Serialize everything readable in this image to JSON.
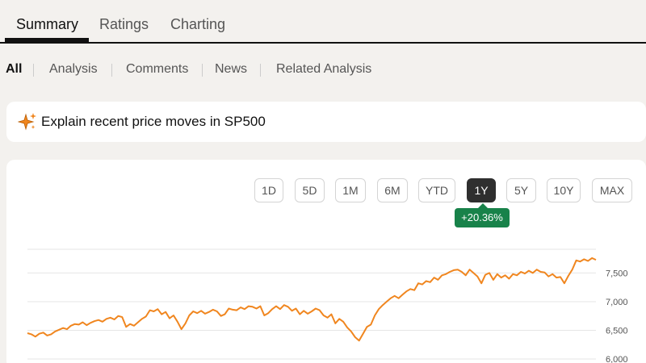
{
  "tabs": [
    {
      "label": "Summary",
      "active": true
    },
    {
      "label": "Ratings",
      "active": false
    },
    {
      "label": "Charting",
      "active": false
    }
  ],
  "subnav": [
    {
      "label": "All",
      "active": true
    },
    {
      "label": "Analysis",
      "active": false
    },
    {
      "label": "Comments",
      "active": false
    },
    {
      "label": "News",
      "active": false
    },
    {
      "label": "Related Analysis",
      "active": false
    }
  ],
  "explain": {
    "icon": "sparkle-icon",
    "text": "Explain recent price moves in SP500"
  },
  "ranges": [
    "1D",
    "5D",
    "1M",
    "6M",
    "YTD",
    "1Y",
    "5Y",
    "10Y",
    "MAX"
  ],
  "selected_range": "1Y",
  "change_badge": "+20.36%",
  "colors": {
    "line": "#f0861f",
    "badge": "#18824a",
    "active_button": "#2f2f2f"
  },
  "chart_data": {
    "type": "line",
    "period": "1Y",
    "y_ticks": [
      "7,500",
      "7,000",
      "6,500",
      "6,000"
    ],
    "y_tick_values": [
      7500,
      7000,
      6500,
      6000
    ],
    "ylim": [
      6000,
      7700
    ],
    "grid": true,
    "series": [
      {
        "values": [
          6450,
          6430,
          6390,
          6440,
          6460,
          6410,
          6430,
          6480,
          6510,
          6540,
          6520,
          6580,
          6610,
          6600,
          6640,
          6590,
          6630,
          6660,
          6680,
          6650,
          6700,
          6720,
          6690,
          6750,
          6730,
          6560,
          6610,
          6580,
          6640,
          6700,
          6740,
          6850,
          6830,
          6870,
          6780,
          6820,
          6710,
          6760,
          6650,
          6520,
          6620,
          6760,
          6830,
          6800,
          6840,
          6790,
          6820,
          6860,
          6830,
          6750,
          6780,
          6880,
          6860,
          6850,
          6900,
          6870,
          6920,
          6910,
          6880,
          6920,
          6760,
          6800,
          6870,
          6920,
          6870,
          6940,
          6910,
          6840,
          6880,
          6780,
          6840,
          6790,
          6830,
          6880,
          6850,
          6760,
          6720,
          6780,
          6620,
          6700,
          6650,
          6550,
          6480,
          6380,
          6320,
          6440,
          6560,
          6600,
          6760,
          6870,
          6940,
          7000,
          7060,
          7100,
          7060,
          7120,
          7180,
          7220,
          7200,
          7320,
          7300,
          7360,
          7340,
          7420,
          7380,
          7460,
          7480,
          7520,
          7550,
          7560,
          7520,
          7460,
          7560,
          7500,
          7440,
          7320,
          7470,
          7500,
          7380,
          7480,
          7420,
          7460,
          7400,
          7480,
          7460,
          7520,
          7490,
          7540,
          7500,
          7560,
          7520,
          7510,
          7440,
          7480,
          7420,
          7430,
          7320,
          7450,
          7560,
          7720,
          7700,
          7740,
          7710,
          7760,
          7730
        ]
      }
    ]
  }
}
